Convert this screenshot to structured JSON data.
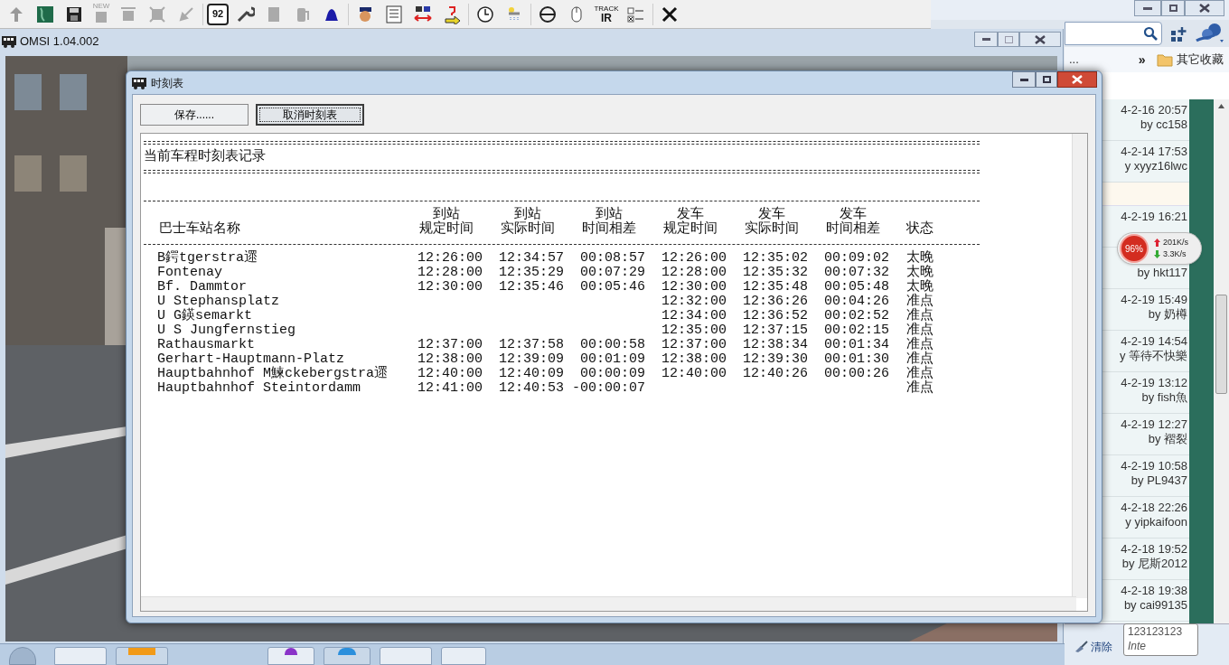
{
  "toolbar": {
    "new_caption": "NEW",
    "bus_number": "92",
    "track_ir": [
      "TRACK",
      "IR"
    ]
  },
  "game_window": {
    "title": "OMSI 1.04.002"
  },
  "dialog": {
    "title": "时刻表",
    "buttons": [
      {
        "label": "保存......",
        "focused": false
      },
      {
        "label": "取消时刻表",
        "focused": true
      }
    ],
    "report_title": "当前车程时刻表记录",
    "columns": [
      {
        "label": "巴士车站名称"
      },
      {
        "group": "到站",
        "label": "规定时间"
      },
      {
        "group": "到站",
        "label": "实际时间"
      },
      {
        "group": "到站",
        "label": "时间相差"
      },
      {
        "group": "发车",
        "label": "规定时间"
      },
      {
        "group": "发车",
        "label": "实际时间"
      },
      {
        "group": "发车",
        "label": "时间相差"
      },
      {
        "label": "状态"
      }
    ],
    "rows": [
      {
        "station": "B鍔tgerstra遝",
        "arr_sched": "12:26:00",
        "arr_actual": "12:34:57",
        "arr_diff": "00:08:57",
        "dep_sched": "12:26:00",
        "dep_actual": "12:35:02",
        "dep_diff": "00:09:02",
        "status": "太晚"
      },
      {
        "station": "Fontenay",
        "arr_sched": "12:28:00",
        "arr_actual": "12:35:29",
        "arr_diff": "00:07:29",
        "dep_sched": "12:28:00",
        "dep_actual": "12:35:32",
        "dep_diff": "00:07:32",
        "status": "太晚"
      },
      {
        "station": "Bf. Dammtor",
        "arr_sched": "12:30:00",
        "arr_actual": "12:35:46",
        "arr_diff": "00:05:46",
        "dep_sched": "12:30:00",
        "dep_actual": "12:35:48",
        "dep_diff": "00:05:48",
        "status": "太晚"
      },
      {
        "station": "U Stephansplatz",
        "dep_sched": "12:32:00",
        "dep_actual": "12:36:26",
        "dep_diff": "00:04:26",
        "status": "准点"
      },
      {
        "station": "U G鍈semarkt",
        "dep_sched": "12:34:00",
        "dep_actual": "12:36:52",
        "dep_diff": "00:02:52",
        "status": "准点"
      },
      {
        "station": "U S Jungfernstieg",
        "dep_sched": "12:35:00",
        "dep_actual": "12:37:15",
        "dep_diff": "00:02:15",
        "status": "准点"
      },
      {
        "station": "Rathausmarkt",
        "arr_sched": "12:37:00",
        "arr_actual": "12:37:58",
        "arr_diff": "00:00:58",
        "dep_sched": "12:37:00",
        "dep_actual": "12:38:34",
        "dep_diff": "00:01:34",
        "status": "准点"
      },
      {
        "station": "Gerhart-Hauptmann-Platz",
        "arr_sched": "12:38:00",
        "arr_actual": "12:39:09",
        "arr_diff": "00:01:09",
        "dep_sched": "12:38:00",
        "dep_actual": "12:39:30",
        "dep_diff": "00:01:30",
        "status": "准点"
      },
      {
        "station": "Hauptbahnhof M鰊ckebergstra遝",
        "arr_sched": "12:40:00",
        "arr_actual": "12:40:09",
        "arr_diff": "00:00:09",
        "dep_sched": "12:40:00",
        "dep_actual": "12:40:26",
        "dep_diff": "00:00:26",
        "status": "准点"
      },
      {
        "station": "Hauptbahnhof Steintordamm",
        "arr_sched": "12:41:00",
        "arr_actual": "12:40:53",
        "arr_diff": "-00:00:07",
        "status": "准点"
      }
    ]
  },
  "browser": {
    "bookmarks": {
      "overflow": "...",
      "more": "»",
      "folder": "其它收藏"
    },
    "posts": [
      {
        "kind": "post",
        "date": "4-2-16 20:57",
        "author": "by cc158"
      },
      {
        "kind": "post",
        "date": "4-2-14 17:53",
        "author": "y xyyz16lwc"
      },
      {
        "kind": "spacer"
      },
      {
        "kind": "post",
        "date": "4-2-19 16:21"
      },
      {
        "kind": "post",
        "author": "by hkt117"
      },
      {
        "kind": "post",
        "date": "4-2-19 15:49",
        "author": "by 奶樽"
      },
      {
        "kind": "post",
        "date": "4-2-19 14:54",
        "author": "y 等待不快樂"
      },
      {
        "kind": "post",
        "date": "4-2-19 13:12",
        "author": "by fish魚"
      },
      {
        "kind": "post",
        "date": "4-2-19 12:27",
        "author": "by 褶裂"
      },
      {
        "kind": "post",
        "date": "4-2-19 10:58",
        "author": "by PL9437"
      },
      {
        "kind": "post",
        "date": "4-2-18 22:26",
        "author": "y yipkaifoon"
      },
      {
        "kind": "post",
        "date": "4-2-18 19:52",
        "author": "by 尼斯2012"
      },
      {
        "kind": "post",
        "date": "4-2-18 19:38",
        "author": "by cai99135"
      }
    ],
    "net_meter": {
      "percent": "96%",
      "up": "201K/s",
      "down": "3.3K/s"
    },
    "tooltip": [
      "123123123",
      "Inte"
    ],
    "clear_button": "清除"
  }
}
